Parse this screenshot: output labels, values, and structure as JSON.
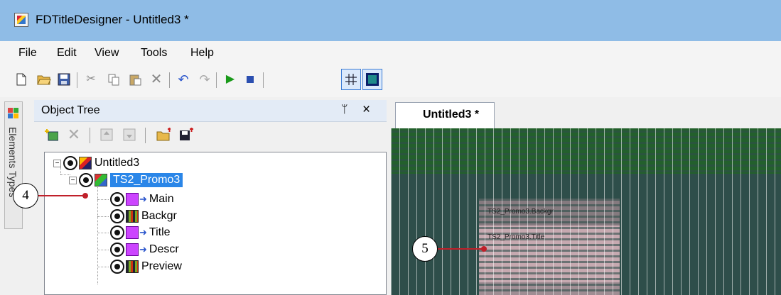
{
  "window": {
    "title": "FDTitleDesigner - Untitled3 *"
  },
  "menu": {
    "items": [
      "File",
      "Edit",
      "View",
      "Tools",
      "Help"
    ]
  },
  "side_strip": {
    "label": "Elements Types"
  },
  "object_tree": {
    "title": "Object Tree",
    "pin_glyph": "ᛘ",
    "close_glyph": "×",
    "root": "Untitled3",
    "group": "TS2_Promo3",
    "children": [
      "Main",
      "Backgr",
      "Title",
      "Descr",
      "Preview"
    ]
  },
  "document_tab": {
    "label": "Untitled3 *"
  },
  "canvas": {
    "labels": {
      "backgr": "TS2_Promo3.Backgr",
      "title": "TS2_Promo3.Title"
    }
  },
  "callouts": {
    "four": "4",
    "five": "5"
  },
  "colors": {
    "titlebar": "#8fbce6",
    "selection": "#2a86e8",
    "callout_line": "#c0202a"
  }
}
